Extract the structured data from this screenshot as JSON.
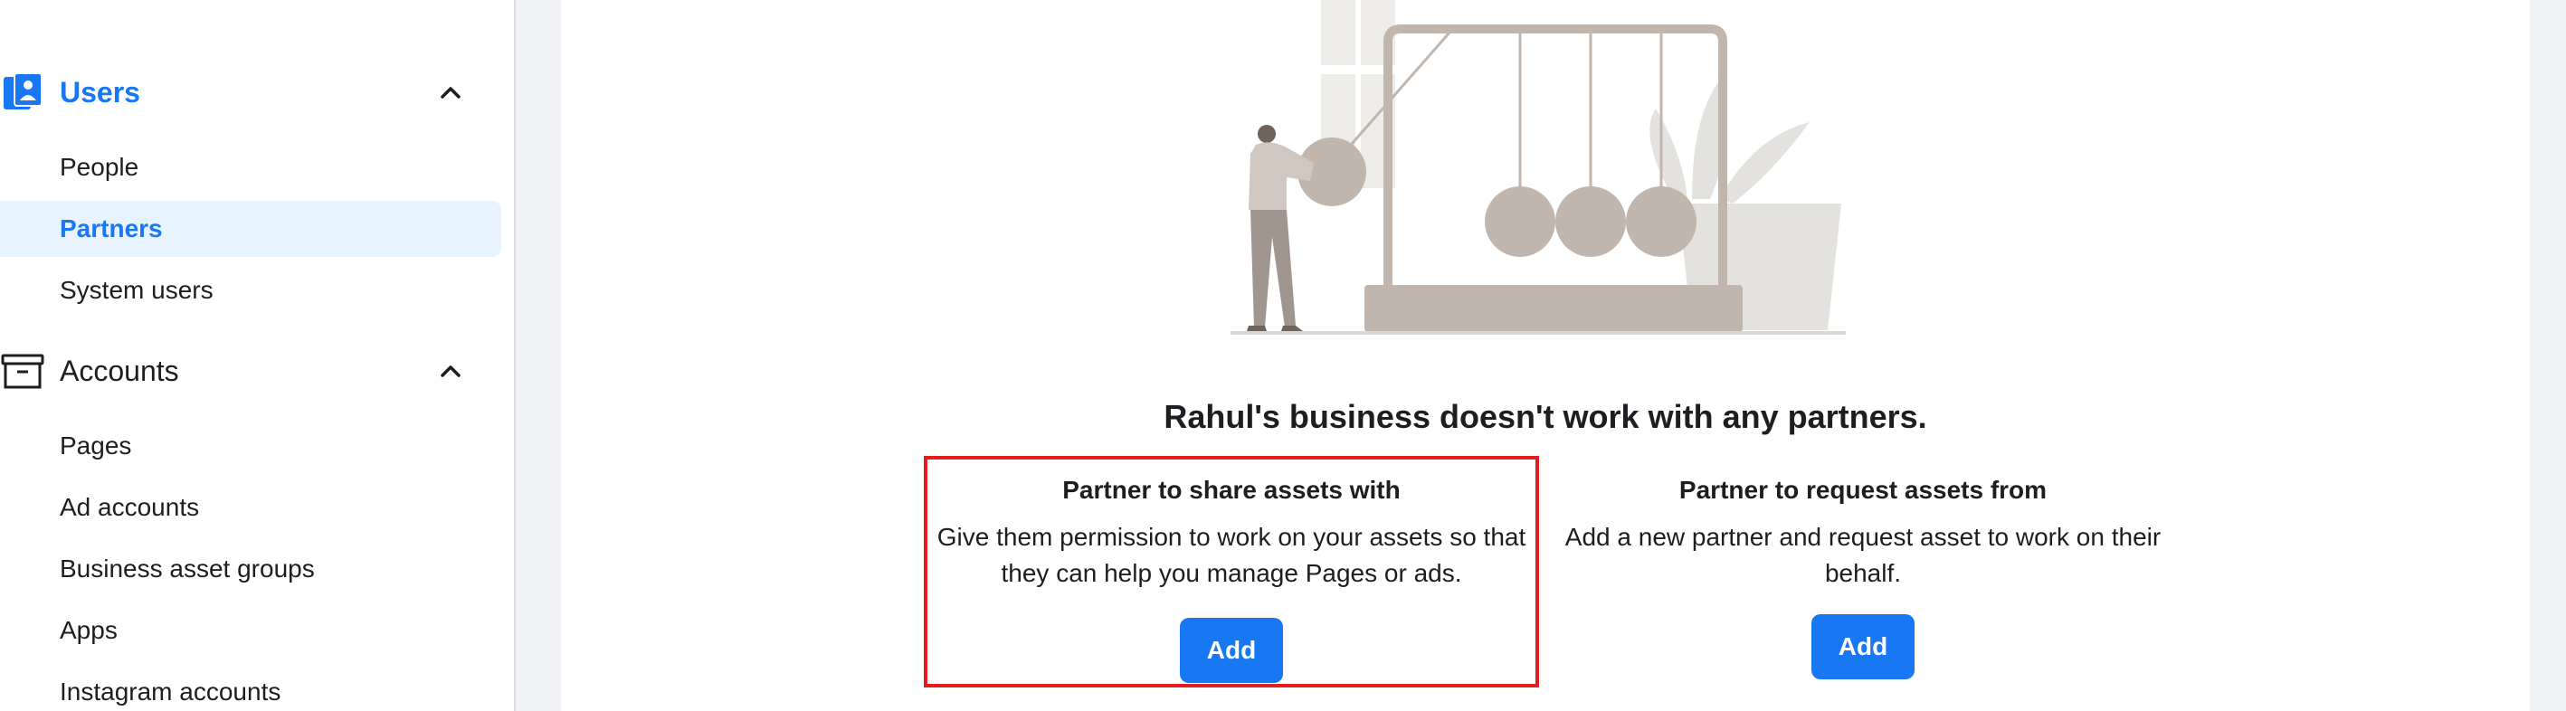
{
  "sidebar": {
    "users_section": {
      "title": "Users",
      "items": [
        "People",
        "Partners",
        "System users"
      ],
      "selected": "Partners"
    },
    "accounts_section": {
      "title": "Accounts",
      "items": [
        "Pages",
        "Ad accounts",
        "Business asset groups",
        "Apps",
        "Instagram accounts"
      ]
    }
  },
  "main": {
    "empty_title": "Rahul's business doesn't work with any partners.",
    "options": [
      {
        "title": "Partner to share assets with",
        "description_line1": "Give them permission to work on your assets so that",
        "description_line2": "they can help you manage Pages or ads.",
        "button_label": "Add",
        "highlighted": true
      },
      {
        "title": "Partner to request assets from",
        "description_line1": "Add a new partner and request asset to work on their",
        "description_line2": "behalf.",
        "button_label": "Add",
        "highlighted": false
      }
    ]
  },
  "colors": {
    "accent": "#1877f2",
    "selected_bg": "#e7f3ff",
    "highlight_border": "#e41e1e",
    "illustration": "#c0b6ae"
  },
  "icons": {
    "users_section": "users-icon",
    "accounts_section": "briefcase-icon",
    "collapse": "chevron-up-icon"
  }
}
